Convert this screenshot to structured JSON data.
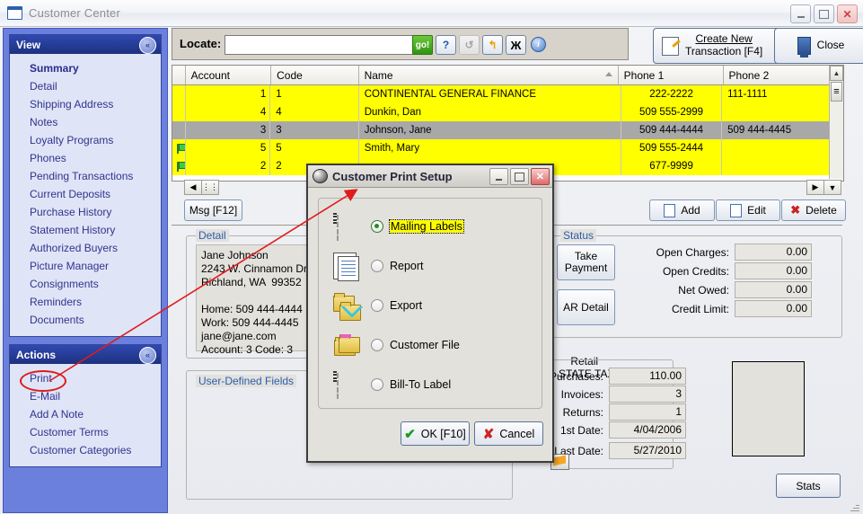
{
  "window": {
    "title": "Customer Center",
    "minimize": "_",
    "maximize": "□",
    "close": "✕"
  },
  "sidebar": {
    "view": {
      "header": "View",
      "collapse_icon": "«",
      "items": [
        {
          "label": "Summary",
          "selected": true
        },
        {
          "label": "Detail"
        },
        {
          "label": "Shipping Address"
        },
        {
          "label": "Notes"
        },
        {
          "label": "Loyalty Programs"
        },
        {
          "label": "Phones"
        },
        {
          "label": "Pending Transactions"
        },
        {
          "label": "Current Deposits"
        },
        {
          "label": "Purchase History"
        },
        {
          "label": "Statement History"
        },
        {
          "label": "Authorized Buyers"
        },
        {
          "label": "Picture Manager"
        },
        {
          "label": "Consignments"
        },
        {
          "label": "Reminders"
        },
        {
          "label": "Documents"
        }
      ]
    },
    "actions": {
      "header": "Actions",
      "collapse_icon": "«",
      "items": [
        {
          "label": "Print",
          "highlighted": true
        },
        {
          "label": "E-Mail"
        },
        {
          "label": "Add A Note"
        },
        {
          "label": "Customer Terms"
        },
        {
          "label": "Customer Categories"
        }
      ]
    }
  },
  "toolbar": {
    "locate_label": "Locate:",
    "locate_value": "",
    "locate_placeholder": "",
    "go_label": "go!",
    "help_label": "?",
    "refresh_label": "↺",
    "flag_label": "↰",
    "binoculars_label": "Ж",
    "info_label": "i",
    "create_new_line1": "Create New",
    "create_new_line2": "Transaction [F4]",
    "create_new_underline": "C",
    "close_label": "Close"
  },
  "grid": {
    "columns": [
      "Account",
      "Code",
      "Name",
      "Phone 1",
      "Phone 2"
    ],
    "sorted_column": "Name",
    "rows": [
      {
        "flag": false,
        "account": "1",
        "code": "1",
        "name": "CONTINENTAL GENERAL FINANCE",
        "phone1": "222-2222",
        "phone2": "111-1111",
        "selected": false
      },
      {
        "flag": false,
        "account": "4",
        "code": "4",
        "name": "Dunkin, Dan",
        "phone1": "509  555-2999",
        "phone2": "",
        "selected": false
      },
      {
        "flag": false,
        "account": "3",
        "code": "3",
        "name": "Johnson, Jane",
        "phone1": "509  444-4444",
        "phone2": "509  444-4445",
        "selected": true
      },
      {
        "flag": true,
        "account": "5",
        "code": "5",
        "name": "Smith, Mary",
        "phone1": "509  555-2444",
        "phone2": "",
        "selected": false
      },
      {
        "flag": true,
        "account": "2",
        "code": "2",
        "name": "",
        "phone1": "677-9999",
        "phone2": "",
        "selected": false
      }
    ],
    "scroll_up": "▲",
    "scroll_down": "▼",
    "scroll_left": "◀",
    "scroll_right": "▶"
  },
  "actionbar": {
    "msg_label": "Msg [F12]",
    "add_label": "Add",
    "edit_label": "Edit",
    "delete_label": "Delete"
  },
  "detail": {
    "group_label": "Detail",
    "text": "Jane Johnson\n2243 W. Cinnamon Drive\nRichland, WA  99352\n\nHome: 509 444-4444\nWork: 509 444-4445\njane@jane.com\nAccount: 3 Code: 3"
  },
  "user_defined": {
    "group_label": "User-Defined Fields"
  },
  "status": {
    "group_label": "Status",
    "take_payment_line1": "Take",
    "take_payment_line2": "Payment",
    "ar_detail_label": "AR Detail",
    "fields": [
      {
        "label": "Open Charges:",
        "value": "0.00"
      },
      {
        "label": "Open Credits:",
        "value": "0.00"
      },
      {
        "label": "Net Owed:",
        "value": "0.00"
      },
      {
        "label": "Credit Limit:",
        "value": "0.00"
      }
    ]
  },
  "stats": {
    "category_line1": "Retail",
    "category_line2": "STATE TAX",
    "fields": [
      {
        "label": "Purchases:",
        "value": "110.00"
      },
      {
        "label": "Invoices:",
        "value": "3"
      },
      {
        "label": "Returns:",
        "value": "1"
      },
      {
        "label": "1st Date:",
        "value": "4/04/2006"
      },
      {
        "label": "Last Date:",
        "value": "5/27/2010"
      }
    ],
    "stats_button": "Stats"
  },
  "dialog": {
    "title": "Customer Print Setup",
    "minimize": "_",
    "maximize": "□",
    "close": "✕",
    "options": [
      {
        "label": "Mailing Labels",
        "icon": "mailing-labels-icon",
        "selected": true
      },
      {
        "label": "Report",
        "icon": "report-icon",
        "selected": false
      },
      {
        "label": "Export",
        "icon": "export-icon",
        "selected": false
      },
      {
        "label": "Customer File",
        "icon": "customer-file-icon",
        "selected": false
      },
      {
        "label": "Bill-To Label",
        "icon": "bill-to-label-icon",
        "selected": false
      }
    ],
    "ok_label": "OK [F10]",
    "cancel_label": "Cancel"
  },
  "annotation": {
    "color": "#e01b1b",
    "from": "Print",
    "to": "Customer Print Setup"
  }
}
